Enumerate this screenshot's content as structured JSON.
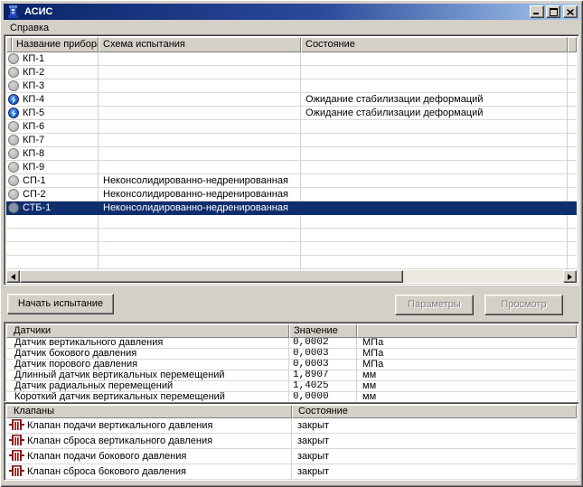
{
  "window": {
    "title": "АСИС"
  },
  "menu": {
    "items": [
      "Справка"
    ]
  },
  "device_table": {
    "columns": [
      "Название прибора",
      "Схема испытания",
      "Состояние"
    ],
    "rows": [
      {
        "name": "КП-1",
        "scheme": "",
        "state": "",
        "icon": "idle",
        "selected": false
      },
      {
        "name": "КП-2",
        "scheme": "",
        "state": "",
        "icon": "idle",
        "selected": false
      },
      {
        "name": "КП-3",
        "scheme": "",
        "state": "",
        "icon": "idle",
        "selected": false
      },
      {
        "name": "КП-4",
        "scheme": "",
        "state": "Ожидание стабилизации деформаций",
        "icon": "active",
        "selected": false
      },
      {
        "name": "КП-5",
        "scheme": "",
        "state": "Ожидание стабилизации деформаций",
        "icon": "active",
        "selected": false
      },
      {
        "name": "КП-6",
        "scheme": "",
        "state": "",
        "icon": "idle",
        "selected": false
      },
      {
        "name": "КП-7",
        "scheme": "",
        "state": "",
        "icon": "idle",
        "selected": false
      },
      {
        "name": "КП-8",
        "scheme": "",
        "state": "",
        "icon": "idle",
        "selected": false
      },
      {
        "name": "КП-9",
        "scheme": "",
        "state": "",
        "icon": "idle",
        "selected": false
      },
      {
        "name": "СП-1",
        "scheme": "Неконсолидированно-недренированная",
        "state": "",
        "icon": "idle",
        "selected": false
      },
      {
        "name": "СП-2",
        "scheme": "Неконсолидированно-недренированная",
        "state": "",
        "icon": "idle",
        "selected": false
      },
      {
        "name": "СТБ-1",
        "scheme": "Неконсолидированно-недренированная",
        "state": "",
        "icon": "idle",
        "selected": true
      }
    ]
  },
  "actions": {
    "start": "Начать испытание",
    "parameters": "Параметры",
    "view": "Просмотр"
  },
  "sensors_table": {
    "columns": [
      "Датчики",
      "Значение",
      ""
    ],
    "rows": [
      {
        "name": "Датчик вертикального давления",
        "value": "0,0002",
        "unit": "МПа"
      },
      {
        "name": "Датчик бокового давления",
        "value": "0,0003",
        "unit": "МПа"
      },
      {
        "name": "Датчик порового давления",
        "value": "0,0003",
        "unit": "МПа"
      },
      {
        "name": "Длинный датчик вертикальных перемещений",
        "value": "1,8907",
        "unit": "мм"
      },
      {
        "name": "Датчик радиальных перемещений",
        "value": "1,4025",
        "unit": "мм"
      },
      {
        "name": "Короткий датчик вертикальных перемещений",
        "value": "0,0000",
        "unit": "мм"
      }
    ]
  },
  "valves_table": {
    "columns": [
      "Клапаны",
      "Состояние"
    ],
    "rows": [
      {
        "name": "Клапан подачи вертикального давления",
        "state": "закрыт"
      },
      {
        "name": "Клапан сброса вертикального давления",
        "state": "закрыт"
      },
      {
        "name": "Клапан подачи бокового давления",
        "state": "закрыт"
      },
      {
        "name": "Клапан сброса бокового давления",
        "state": "закрыт"
      }
    ]
  },
  "colors": {
    "titlebar_left": "#0A246A",
    "titlebar_right": "#A6CAF0",
    "selection": "#0E2E6E",
    "chrome": "#D4D0C8",
    "valve_icon": "#8B1A1A",
    "active_device_icon": "#2B55C8",
    "idle_device_icon": "#ABABAB"
  }
}
